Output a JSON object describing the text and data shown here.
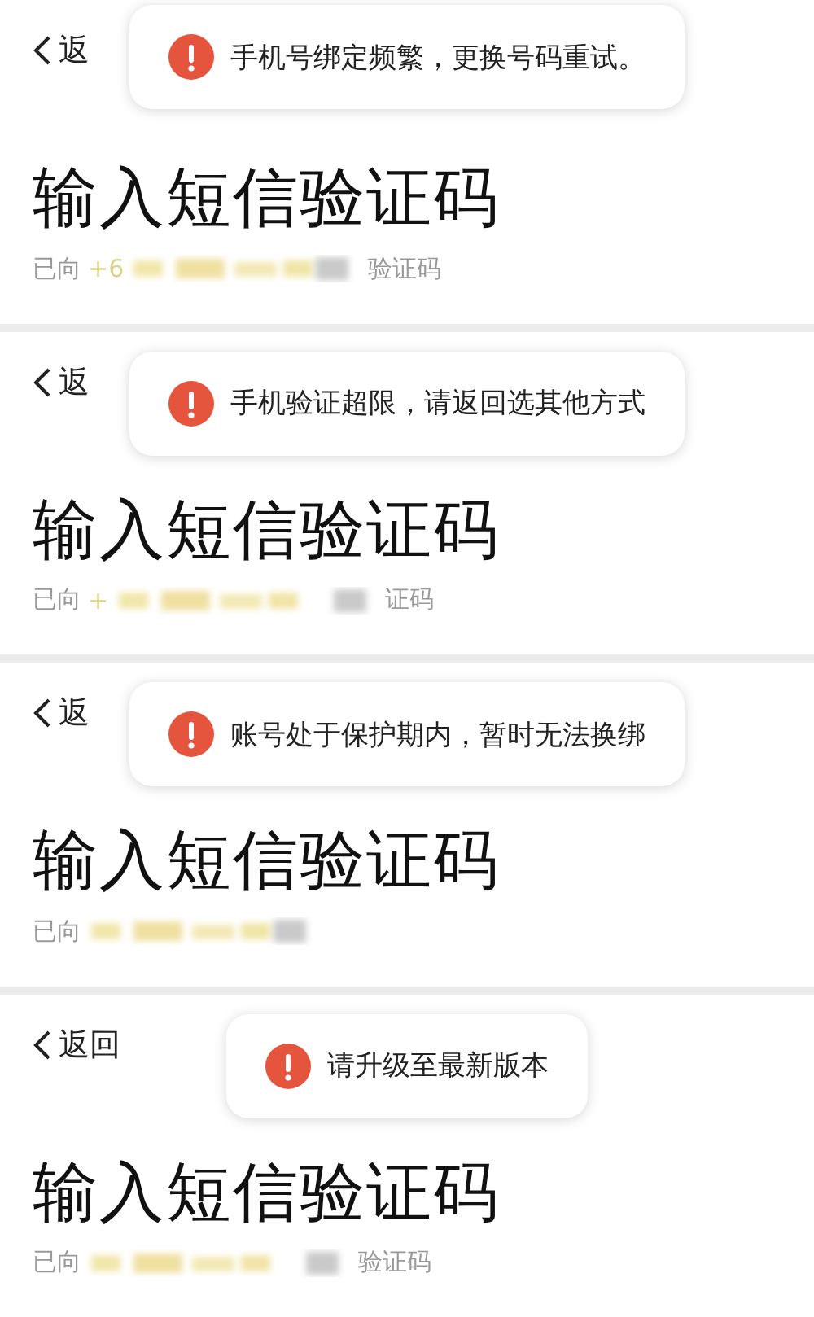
{
  "screens": [
    {
      "back": {
        "label": "返"
      },
      "toast": {
        "kind": "error",
        "message": "手机号绑定频繁，更换号码重试。"
      },
      "title": "输入短信验证码",
      "subtitle": {
        "prefix": "已向",
        "phone_start": "+6",
        "suffix": "验证码"
      }
    },
    {
      "back": {
        "label": "返"
      },
      "toast": {
        "kind": "error",
        "message": "手机验证超限，请返回选其他方式"
      },
      "title": "输入短信验证码",
      "subtitle": {
        "prefix": "已向",
        "phone_start": "+",
        "suffix": "证码"
      }
    },
    {
      "back": {
        "label": "返"
      },
      "toast": {
        "kind": "error",
        "message": "账号处于保护期内，暂时无法换绑"
      },
      "title": "输入短信验证码",
      "subtitle": {
        "prefix": "已向"
      }
    },
    {
      "back": {
        "label": "返回"
      },
      "toast": {
        "kind": "error",
        "message": "请升级至最新版本"
      },
      "title": "输入短信验证码",
      "subtitle": {
        "prefix": "已向",
        "suffix": "验证码"
      }
    }
  ]
}
